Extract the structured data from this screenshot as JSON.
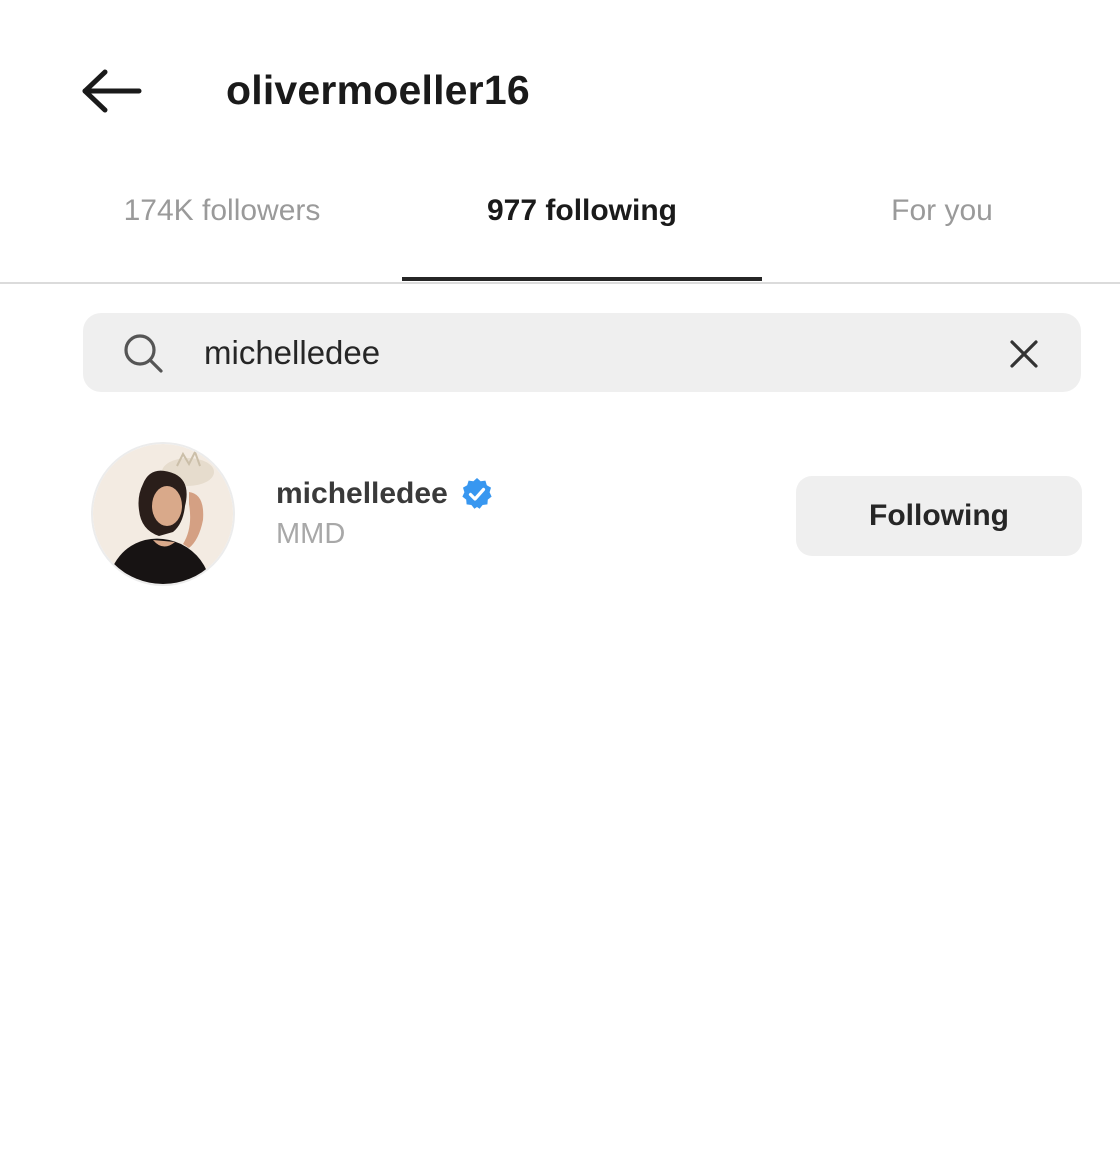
{
  "header": {
    "title": "olivermoeller16",
    "back_icon": "arrow-left-icon"
  },
  "tabs": [
    {
      "label": "174K followers",
      "active": false
    },
    {
      "label": "977 following",
      "active": true
    },
    {
      "label": "For you",
      "active": false
    }
  ],
  "search": {
    "value": "michelledee",
    "icon": "search-icon",
    "clear_icon": "close-icon"
  },
  "results": [
    {
      "username": "michelledee",
      "full_name": "MMD",
      "verified": true,
      "button_label": "Following"
    }
  ],
  "colors": {
    "verified_badge": "#3897f0",
    "active_tab_indicator": "#262626",
    "button_bg": "#efefef"
  }
}
